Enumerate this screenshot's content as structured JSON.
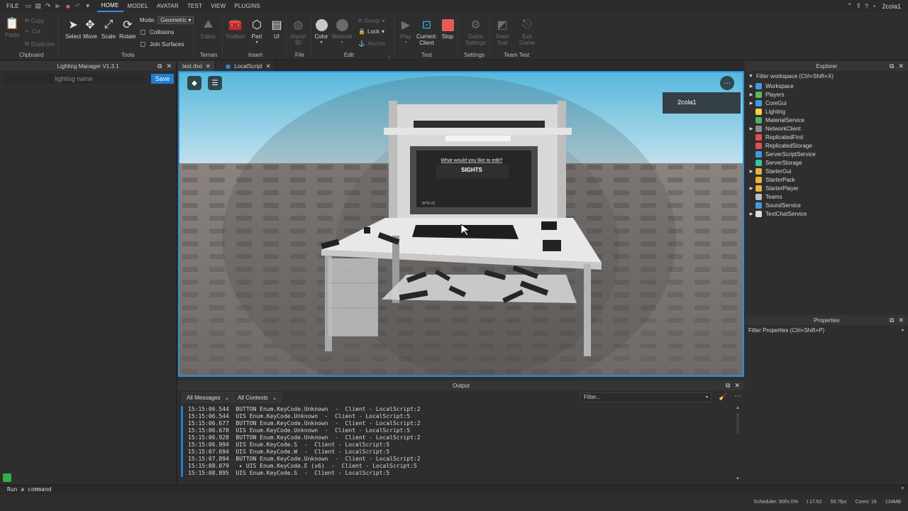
{
  "menubar": {
    "file": "FILE",
    "tabs": [
      "HOME",
      "MODEL",
      "AVATAR",
      "TEST",
      "VIEW",
      "PLUGINS"
    ],
    "active_tab": "HOME",
    "username": "2cola1"
  },
  "ribbon": {
    "clipboard": {
      "paste": "Paste",
      "copy": "Copy",
      "cut": "Cut",
      "duplicate": "Duplicate",
      "group": "Clipboard"
    },
    "tools": {
      "select": "Select",
      "move": "Move",
      "scale": "Scale",
      "rotate": "Rotate",
      "mode_label": "Mode:",
      "mode_value": "Geometric",
      "collisions": "Collisions",
      "join_surfaces": "Join Surfaces",
      "group": "Tools"
    },
    "terrain": {
      "editor": "Editor",
      "group": "Terrain"
    },
    "insert": {
      "toolbox": "Toolbox",
      "part": "Part",
      "ui": "UI",
      "group": "Insert"
    },
    "file": {
      "import3d_l1": "Import",
      "import3d_l2": "3D",
      "group": "File"
    },
    "edit": {
      "color": "Color",
      "material": "Material",
      "group_btn": "Group",
      "lock": "Lock",
      "anchor": "Anchor",
      "group": "Edit"
    },
    "test": {
      "play": "Play",
      "current_client_l1": "Current:",
      "current_client_l2": "Client",
      "stop": "Stop",
      "group": "Test"
    },
    "settings": {
      "game_settings_l1": "Game",
      "game_settings_l2": "Settings",
      "group": "Settings"
    },
    "team_test": {
      "team_test_l1": "Team",
      "team_test_l2": "Test",
      "exit_game_l1": "Exit",
      "exit_game_l2": "Game",
      "group": "Team Test"
    }
  },
  "lighting_manager": {
    "title": "Lighting Manager V1.3.1",
    "name_placeholder": "lighting name",
    "save": "Save"
  },
  "tabs": [
    {
      "label": "test.rbxl"
    },
    {
      "label": "LocalScript"
    }
  ],
  "viewport": {
    "player_name": "2cola1",
    "screen_prompt": "What would you like to edit?",
    "screen_option": "SIGHTS",
    "screen_tag": "WTE-03"
  },
  "output": {
    "title": "Output",
    "messages_filter": "All Messages",
    "contexts_filter": "All Contexts",
    "filter_placeholder": "Filter...",
    "lines": [
      "15:15:06.544  BUTTON Enum.KeyCode.Unknown  -  Client - LocalScript:2",
      "15:15:06.544  UIS Enum.KeyCode.Unknown  -  Client - LocalScript:5",
      "15:15:06.677  BUTTON Enum.KeyCode.Unknown  -  Client - LocalScript:2",
      "15:15:06.678  UIS Enum.KeyCode.Unknown  -  Client - LocalScript:5",
      "15:15:06.928  BUTTON Enum.KeyCode.Unknown  -  Client - LocalScript:2",
      "15:15:06.994  UIS Enum.KeyCode.S  -  Client - LocalScript:5",
      "15:15:07.694  UIS Enum.KeyCode.W  -  Client - LocalScript:5",
      "15:15:07.894  BUTTON Enum.KeyCode.Unknown  -  Client - LocalScript:2",
      "15:15:08.079   ▸ UIS Enum.KeyCode.E (x6)  -  Client - LocalScript:5",
      "15:15:08.895  UIS Enum.KeyCode.S  -  Client - LocalScript:5"
    ]
  },
  "explorer": {
    "title": "Explorer",
    "filter": "Filter workspace (Ctrl+Shift+X)",
    "items": [
      {
        "label": "Workspace",
        "expandable": true,
        "color": "#3c9be8"
      },
      {
        "label": "Players",
        "expandable": true,
        "color": "#5cb85c"
      },
      {
        "label": "CoreGui",
        "expandable": true,
        "color": "#3c9be8"
      },
      {
        "label": "Lighting",
        "expandable": false,
        "color": "#f2d43a"
      },
      {
        "label": "MaterialService",
        "expandable": false,
        "color": "#4fb06d"
      },
      {
        "label": "NetworkClient",
        "expandable": true,
        "color": "#8a8a8a"
      },
      {
        "label": "ReplicatedFirst",
        "expandable": false,
        "color": "#e05050"
      },
      {
        "label": "ReplicatedStorage",
        "expandable": false,
        "color": "#e05050"
      },
      {
        "label": "ServerScriptService",
        "expandable": false,
        "color": "#3c9be8"
      },
      {
        "label": "ServerStorage",
        "expandable": false,
        "color": "#3cc0a0"
      },
      {
        "label": "StarterGui",
        "expandable": true,
        "color": "#e8b23c"
      },
      {
        "label": "StarterPack",
        "expandable": false,
        "color": "#e8b23c"
      },
      {
        "label": "StarterPlayer",
        "expandable": true,
        "color": "#e8b23c"
      },
      {
        "label": "Teams",
        "expandable": false,
        "color": "#c0c0c0"
      },
      {
        "label": "SoundService",
        "expandable": false,
        "color": "#3c9be8"
      },
      {
        "label": "TextChatService",
        "expandable": true,
        "color": "#dddddd"
      }
    ]
  },
  "properties": {
    "title": "Properties",
    "filter": "Filter Properties (Ctrl+Shift+P)"
  },
  "command_bar": {
    "placeholder": "Run a command"
  },
  "status": {
    "scheduler": "Scheduler: 90f/s 0%",
    "time": "t 17.62",
    "fps": "59.7fps",
    "cores": "Cores: 16",
    "memory": "134MB"
  },
  "colors": {
    "accent": "#1f7fd1",
    "stop": "#e85a5a",
    "viewport_border": "#2b8fd6"
  }
}
